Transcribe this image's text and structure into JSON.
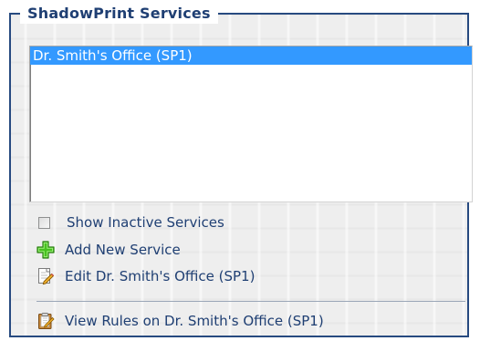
{
  "panel": {
    "title": "ShadowPrint Services",
    "services": [
      {
        "label": "Dr. Smith's Office (SP1)",
        "selected": true
      }
    ],
    "options": {
      "show_inactive_label": "Show Inactive Services",
      "show_inactive_checked": false
    },
    "actions": {
      "add_new_label": "Add New Service",
      "edit_label": "Edit Dr. Smith's Office (SP1)",
      "view_rules_label": "View Rules on Dr. Smith's Office (SP1)"
    },
    "icons": {
      "add": "plus-icon",
      "edit": "edit-document-icon",
      "view_rules": "rules-clipboard-icon"
    },
    "colors": {
      "border": "#274a80",
      "text": "#1f3f73",
      "selection": "#3399ff"
    }
  }
}
